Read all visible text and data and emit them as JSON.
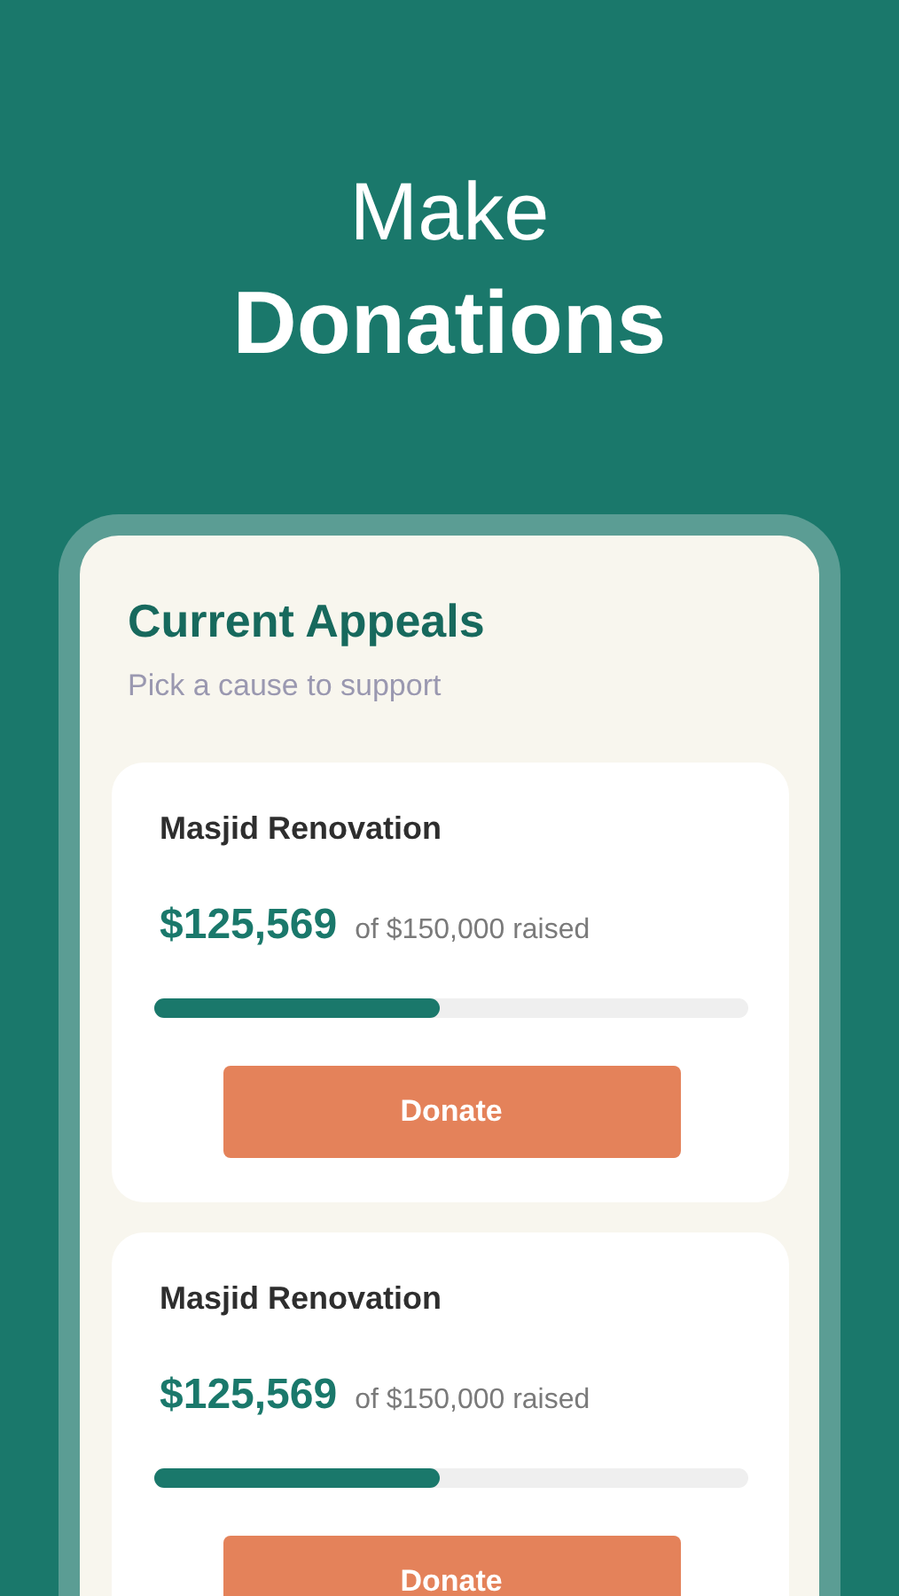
{
  "headline": {
    "line_1": "Make",
    "line_2": "Donations"
  },
  "panel": {
    "title": "Current Appeals",
    "subtitle": "Pick a cause to support"
  },
  "appeals": [
    {
      "name": "Masjid Renovation",
      "raised": "$125,569",
      "goal_text": "of $150,000 raised",
      "level": 0.48,
      "button": "Donate"
    },
    {
      "name": "Masjid Renovation",
      "raised": "$125,569",
      "goal_text": "of $150,000 raised",
      "level": 0.48,
      "button": "Donate"
    }
  ]
}
